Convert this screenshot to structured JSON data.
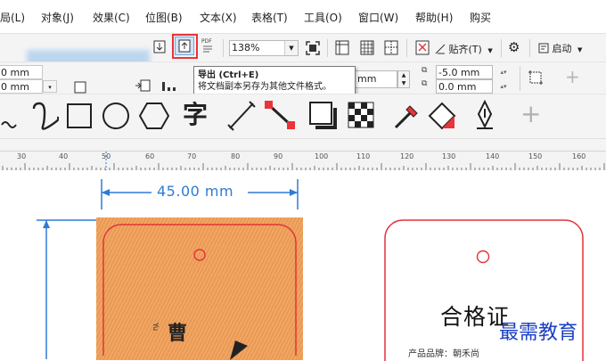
{
  "menu": [
    "局(L)",
    "对象(J)",
    "效果(C)",
    "位图(B)",
    "文本(X)",
    "表格(T)",
    "工具(O)",
    "窗口(W)",
    "帮助(H)",
    "购买"
  ],
  "toolbar": {
    "zoom_value": "138%",
    "pdf_label": "PDF",
    "align_label": "贴齐(T)",
    "launch_label": "启动"
  },
  "property_bar": {
    "size_w": "0 mm",
    "size_h": "0 mm",
    "width_partial": "mm",
    "offset_x": "-5.0 mm",
    "offset_y": "0.0 mm"
  },
  "tooltip": {
    "title": "导出 (Ctrl+E)",
    "description": "将文档副本另存为其他文件格式。"
  },
  "toolbox": {
    "text_tool_glyph": "字"
  },
  "ruler": {
    "labels": [
      "30",
      "40",
      "50",
      "60",
      "70",
      "80",
      "90",
      "100",
      "110",
      "120",
      "130",
      "140",
      "150",
      "160"
    ]
  },
  "canvas": {
    "dimension_label": "45.00 mm",
    "tag_title": "合格证",
    "tag_line": "产品品牌：朝禾尚",
    "watermark": "最需教育",
    "card_glyph": "曹",
    "card_small_text": "Yu"
  },
  "colors": {
    "accent_blue": "#2e7bd6",
    "highlight_red": "#e8343a",
    "card_orange": "#f1a563",
    "tag_border": "#e2323a",
    "watermark_blue": "#1a3fc4"
  }
}
